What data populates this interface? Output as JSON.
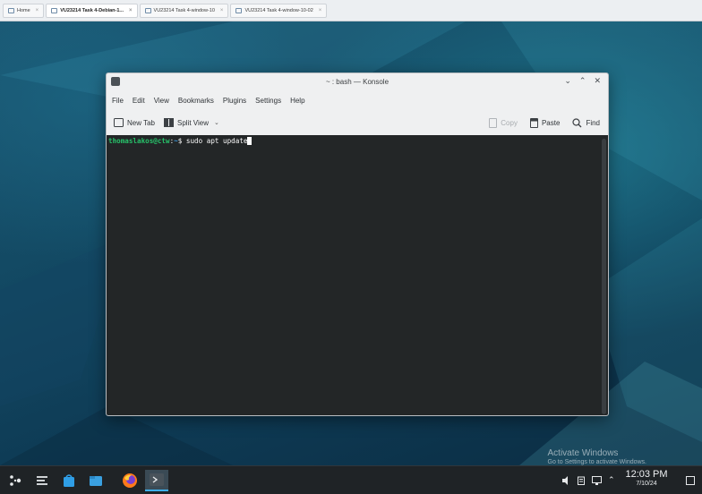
{
  "vm_tabs": [
    {
      "label": "Home"
    },
    {
      "label": "VU23214 Task 4-Debian-1..."
    },
    {
      "label": "VU23214 Task 4-window-10"
    },
    {
      "label": "VU23214 Task 4-window-10-02"
    }
  ],
  "window": {
    "title": "~ : bash — Konsole",
    "menu": [
      "File",
      "Edit",
      "View",
      "Bookmarks",
      "Plugins",
      "Settings",
      "Help"
    ],
    "toolbar": {
      "new_tab": "New Tab",
      "split_view": "Split View",
      "copy": "Copy",
      "paste": "Paste",
      "find": "Find"
    },
    "terminal": {
      "prompt_user": "thomaslakos@ctw",
      "prompt_sep": ":",
      "prompt_path": "~",
      "prompt_symbol": "$",
      "command": " sudo apt update"
    }
  },
  "watermark": {
    "line1": "Activate Windows",
    "line2": "Go to Settings to activate Windows."
  },
  "taskbar": {
    "time": "12:03 PM",
    "date": "7/10/24",
    "icons": [
      "app-launcher-icon",
      "task-manager-icon",
      "discover-icon",
      "dolphin-file-manager-icon",
      "firefox-icon",
      "konsole-icon"
    ]
  },
  "colors": {
    "terminal_bg": "#232627",
    "prompt_green": "#27c26a",
    "prompt_blue": "#3d9be0",
    "accent": "#3daee9"
  }
}
